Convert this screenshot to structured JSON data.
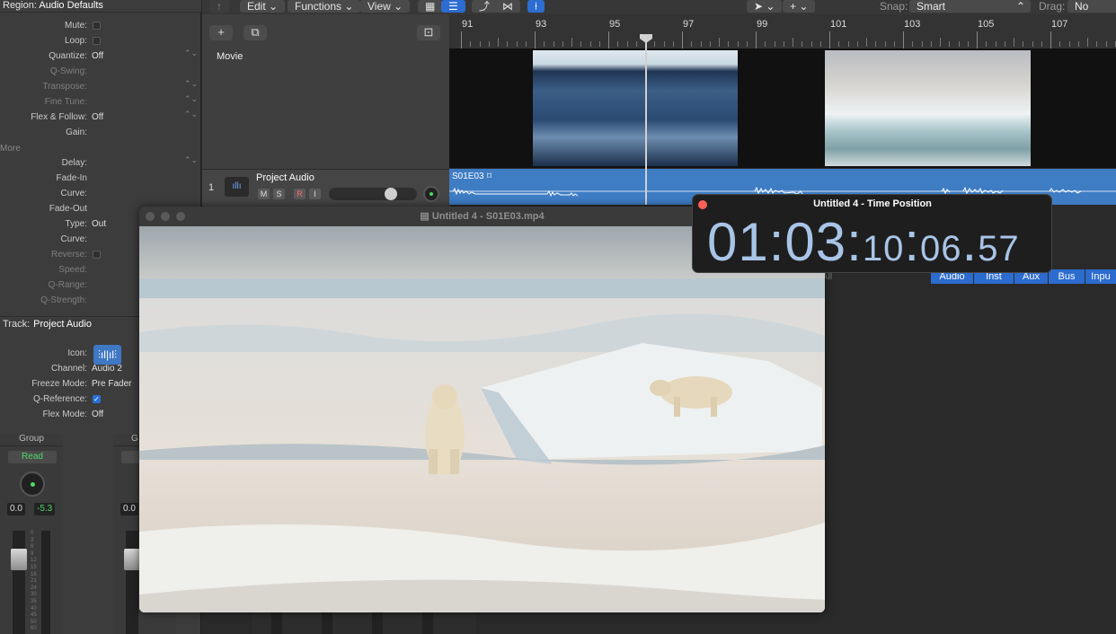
{
  "inspector": {
    "region_label": "Region:",
    "region_name": "Audio Defaults",
    "rows": [
      {
        "label": "Mute:",
        "type": "check",
        "checked": false
      },
      {
        "label": "Loop:",
        "type": "check",
        "checked": false
      },
      {
        "label": "Quantize:",
        "value": "Off"
      },
      {
        "label": "Q-Swing:",
        "value": ""
      },
      {
        "label": "Transpose:",
        "value": ""
      },
      {
        "label": "Fine Tune:",
        "value": ""
      },
      {
        "label": "Flex & Follow:",
        "value": "Off"
      },
      {
        "label": "Gain:",
        "value": ""
      }
    ],
    "more_label": "More",
    "rows2": [
      {
        "label": "Delay:",
        "value": ""
      },
      {
        "label": "Fade-In",
        "value": ""
      },
      {
        "label": "Curve:",
        "value": ""
      },
      {
        "label": "Fade-Out",
        "value": ""
      },
      {
        "label": "Type:",
        "value": "Out"
      },
      {
        "label": "Curve:",
        "value": ""
      },
      {
        "label": "Reverse:",
        "type": "check",
        "checked": false
      },
      {
        "label": "Speed:",
        "value": ""
      },
      {
        "label": "Q-Range:",
        "value": ""
      },
      {
        "label": "Q-Strength:",
        "value": ""
      }
    ],
    "track_label": "Track:",
    "track_name": "Project Audio",
    "track_rows": [
      {
        "label": "Icon:"
      },
      {
        "label": "Channel:",
        "value": "Audio 2"
      },
      {
        "label": "Freeze Mode:",
        "value": "Pre Fader"
      },
      {
        "label": "Q-Reference:",
        "type": "check",
        "checked": true
      },
      {
        "label": "Flex Mode:",
        "value": "Off"
      }
    ]
  },
  "mixer": {
    "strip1": {
      "group": "Group",
      "automation": "Read",
      "vol": "0.0",
      "pan": "-5.3"
    },
    "strip2": {
      "group": "G",
      "automation": "R",
      "vol": "0.0"
    },
    "scale": [
      "0",
      "3",
      "6",
      "9",
      "12",
      "15",
      "18",
      "21",
      "24",
      "30",
      "35",
      "40",
      "45",
      "50",
      "60"
    ]
  },
  "toolbar": {
    "edit": "Edit",
    "functions": "Functions",
    "view": "View",
    "snap_label": "Snap:",
    "snap_value": "Smart",
    "drag_label": "Drag:",
    "drag_value": "No Overla"
  },
  "ruler": {
    "bars": [
      "91",
      "93",
      "95",
      "97",
      "99",
      "101",
      "103",
      "105",
      "107"
    ]
  },
  "tracks": {
    "movie_label": "Movie",
    "track_number": "1",
    "track_name": "Project Audio",
    "btn_m": "M",
    "btn_s": "S",
    "btn_r": "R",
    "btn_i": "I",
    "region_name": "S01E03"
  },
  "mixer_tabs": [
    "Audio",
    "Inst",
    "Aux",
    "Bus",
    "Inpu"
  ],
  "mixer_all": "All",
  "video_window": {
    "title": "Untitled 4 - S01E03.mp4"
  },
  "time_window": {
    "title": "Untitled 4 - Time Position",
    "hours": "01",
    "minutes": "03",
    "seconds": "10",
    "frames": "06",
    "subframes": "57"
  },
  "colors": {
    "accent": "#2d6cd0",
    "region": "#3e7cc4",
    "time_digits": "#a8c4e6",
    "green": "#4cd964"
  }
}
